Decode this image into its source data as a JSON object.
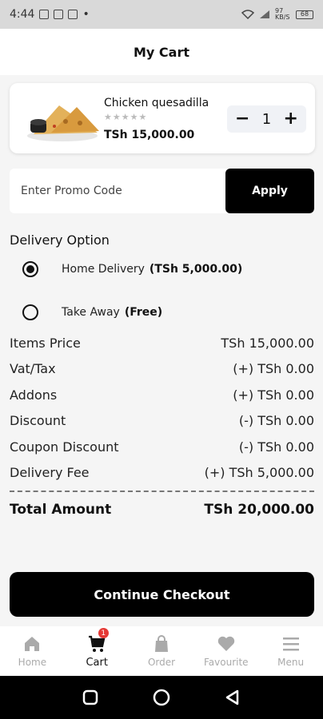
{
  "status_bar": {
    "time": "4:44",
    "dot": "•",
    "network": "97 KB/S",
    "battery": "68"
  },
  "header": {
    "title": "My Cart"
  },
  "cart_item": {
    "name": "Chicken quesadilla",
    "stars": "★★★★★",
    "price": "TSh 15,000.00",
    "quantity": "1",
    "minus": "−",
    "plus": "+"
  },
  "promo": {
    "placeholder": "Enter Promo Code",
    "apply_label": "Apply"
  },
  "delivery": {
    "title": "Delivery Option",
    "options": [
      {
        "label": "Home Delivery",
        "price": "(TSh 5,000.00)",
        "selected": true
      },
      {
        "label": "Take Away",
        "price": "(Free)",
        "selected": false
      }
    ]
  },
  "summary": {
    "rows": [
      {
        "label": "Items Price",
        "value": "TSh 15,000.00"
      },
      {
        "label": "Vat/Tax",
        "value": "(+) TSh 0.00"
      },
      {
        "label": "Addons",
        "value": "(+) TSh 0.00"
      },
      {
        "label": "Discount",
        "value": "(-) TSh 0.00"
      },
      {
        "label": "Coupon Discount",
        "value": "(-) TSh 0.00"
      },
      {
        "label": "Delivery Fee",
        "value": "(+) TSh 5,000.00"
      }
    ],
    "total_label": "Total Amount",
    "total_value": "TSh 20,000.00"
  },
  "checkout": {
    "label": "Continue Checkout"
  },
  "bottom_nav": {
    "items": [
      {
        "label": "Home",
        "icon": "home-icon"
      },
      {
        "label": "Cart",
        "icon": "cart-icon",
        "badge": "1"
      },
      {
        "label": "Order",
        "icon": "bag-icon"
      },
      {
        "label": "Favourite",
        "icon": "heart-icon"
      },
      {
        "label": "Menu",
        "icon": "menu-icon"
      }
    ]
  },
  "colors": {
    "accent": "#000000",
    "badge": "#e53935",
    "inactive": "#aaaaaa"
  }
}
